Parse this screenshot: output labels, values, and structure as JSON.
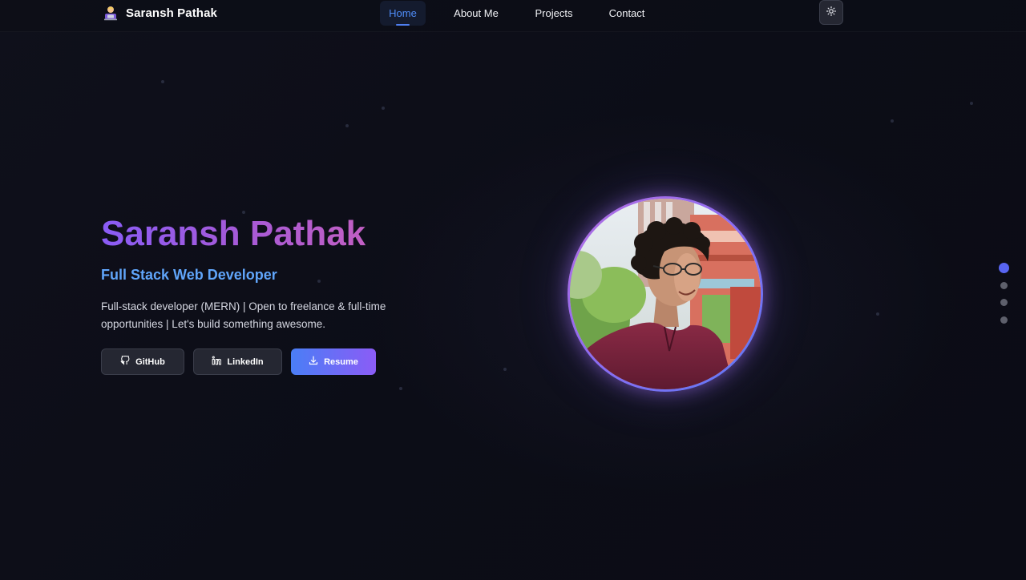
{
  "nav": {
    "brand": "Saransh Pathak",
    "links": [
      {
        "label": "Home",
        "active": true
      },
      {
        "label": "About Me",
        "active": false
      },
      {
        "label": "Projects",
        "active": false
      },
      {
        "label": "Contact",
        "active": false
      }
    ],
    "theme_toggle_icon": "sun-icon"
  },
  "hero": {
    "name": "Saransh Pathak",
    "role": "Full Stack Web Developer",
    "description": "Full-stack developer (MERN) | Open to freelance & full-time opportunities | Let's build something awesome.",
    "buttons": {
      "github": "GitHub",
      "linkedin": "LinkedIn",
      "resume": "Resume"
    }
  },
  "section_dots": {
    "count": 4,
    "active_index": 0
  },
  "colors": {
    "background": "#0d0e18",
    "accent_blue": "#4f8cf7",
    "name_gradient_start": "#8a5cf6",
    "name_gradient_end": "#c25fc3",
    "role": "#60a5fa",
    "resume_gradient_start": "#4a7ef6",
    "resume_gradient_end": "#8b5cf6"
  }
}
